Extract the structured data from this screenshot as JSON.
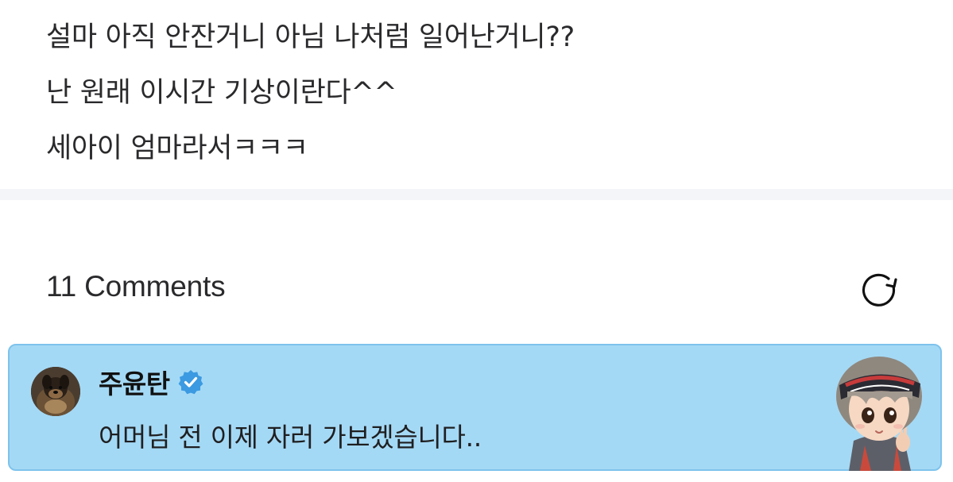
{
  "post": {
    "lines": [
      "설마 아직 안잔거니 아님 나처럼 일어난거니??",
      "난 원래 이시간 기상이란다^^",
      "세아이 엄마라서ㅋㅋㅋ"
    ]
  },
  "comments": {
    "count_label": "11 Comments",
    "refresh_icon": "refresh-icon"
  },
  "comment": {
    "author": "주윤탄",
    "verified_icon": "verified-badge-icon",
    "text": "어머님 전 이제 자러 가보겠습니다..",
    "avatar_icon": "dog-avatar",
    "sticker_icon": "character-sticker"
  },
  "colors": {
    "card_background": "#a4d9f5",
    "card_border": "#7ec3ec",
    "verified": "#3b9ae1",
    "divider": "#f4f5f8"
  }
}
